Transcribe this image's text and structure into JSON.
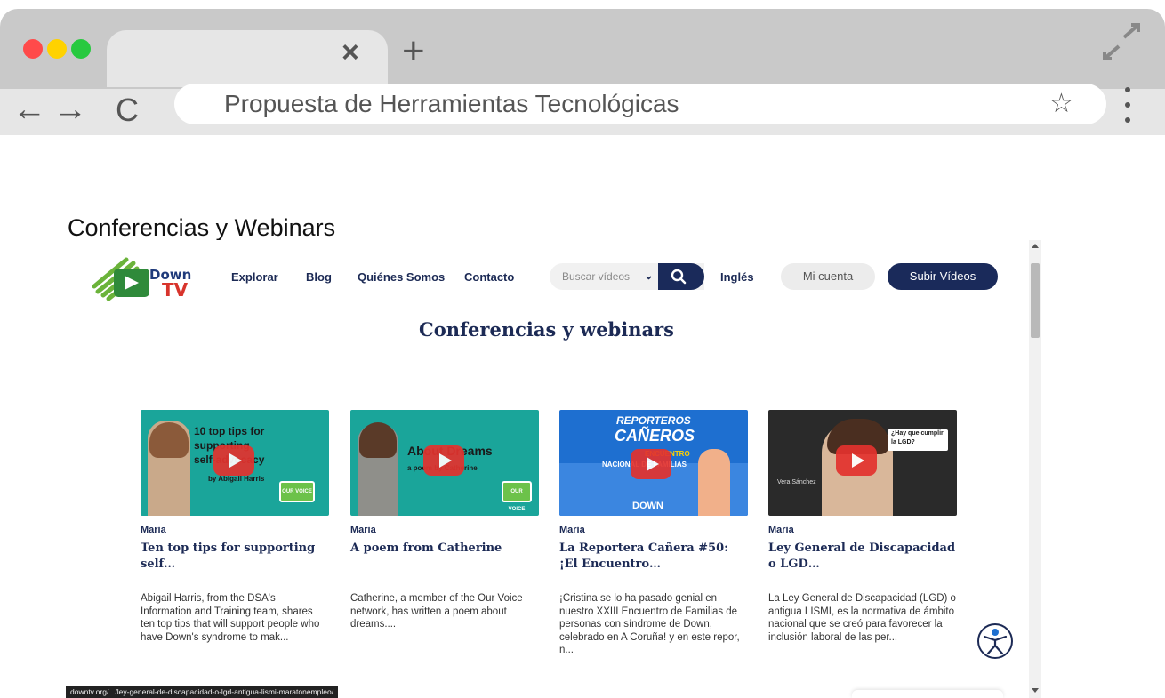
{
  "browser": {
    "tab_close": "×",
    "tab_new": "+",
    "back_arrow": "←",
    "forward_arrow": "→",
    "reload_glyph": "C",
    "address": "Propuesta de Herramientas Tecnológicas",
    "bookmark_glyph": "☆",
    "traffic_lights": [
      "#ff4a4a",
      "#ffd200",
      "#27c93f"
    ]
  },
  "slide": {
    "heading": "Conferencias y Webinars"
  },
  "site": {
    "logo": {
      "word1": "Down",
      "word2": "TV"
    },
    "nav": [
      "Explorar",
      "Blog",
      "Quiénes Somos",
      "Contacto"
    ],
    "search": {
      "placeholder": "Buscar vídeos",
      "chevron": "⌄"
    },
    "language": "Inglés",
    "account_label": "Mi cuenta",
    "upload_label": "Subir Vídeos",
    "page_title": "Conferencias y webinars",
    "colors": {
      "navy": "#1a2a5a",
      "teal": "#1aa59a",
      "blue": "#1e6fd0",
      "red": "#e3322e"
    },
    "cards": [
      {
        "author": "Maria",
        "title": "Ten top tips for supporting self…",
        "description": "Abigail Harris, from the DSA's Information and Training team, shares ten top tips that will support people who have Down's syndrome to mak...",
        "thumb_lines": [
          "10 top tips for",
          "supporting",
          "self-advocacy",
          "by Abigail Harris"
        ],
        "thumb_badge": "OUR VOICE"
      },
      {
        "author": "Maria",
        "title": "A poem from Catherine",
        "description": "Catherine, a member of the Our Voice network, has written a poem about dreams....",
        "thumb_lines": [
          "About Dreams",
          "a poem by Catherine"
        ],
        "thumb_badge": "OUR VOICE"
      },
      {
        "author": "Maria",
        "title": "La Reportera Cañera #50: ¡El Encuentro…",
        "description": "¡Cristina se lo ha pasado genial en nuestro XXIII Encuentro de Familias de personas con síndrome de Down, celebrado en A Coruña! y en este repor, n...",
        "thumb_lines": [
          "REPORTEROS",
          "CAÑEROS",
          "ENCUENTRO",
          "NACIONAL DE FAMILIAS"
        ],
        "thumb_badge": "DOWN"
      },
      {
        "author": "Maria",
        "title": "Ley General de Discapacidad o LGD…",
        "description": "La Ley General de Discapacidad (LGD) o antigua LISMI, es la normativa de ámbito nacional que se creó para favorecer la inclusión laboral de las per...",
        "thumb_lines": [
          "¿Hay que cumplir",
          "la LGD?",
          "Vera Sánchez"
        ],
        "thumb_badge": ""
      }
    ],
    "status_url": "downtv.org/.../ley-general-de-discapacidad-o-lgd-antigua-lismi-maratonempleo/"
  }
}
